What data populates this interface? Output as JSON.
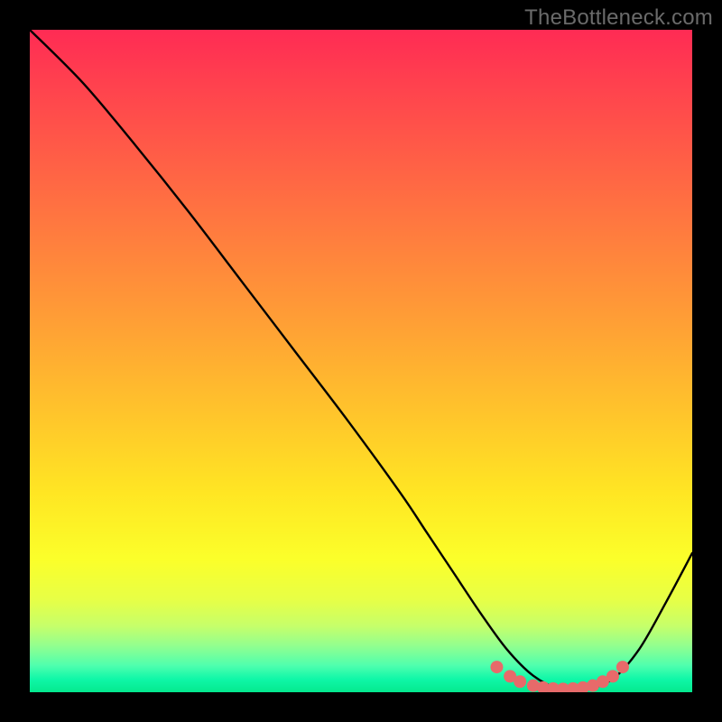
{
  "watermark": "TheBottleneck.com",
  "chart_data": {
    "type": "line",
    "title": "",
    "xlabel": "",
    "ylabel": "",
    "xlim": [
      0,
      100
    ],
    "ylim": [
      0,
      100
    ],
    "series": [
      {
        "name": "curve",
        "color": "#000000",
        "x": [
          0,
          8,
          16,
          24,
          32,
          40,
          48,
          56,
          60,
          64,
          68,
          72,
          76,
          80,
          84,
          88,
          92,
          96,
          100
        ],
        "y": [
          100,
          92,
          82.5,
          72.5,
          62,
          51.5,
          41,
          30,
          24,
          18,
          12,
          6.5,
          2.5,
          0.5,
          0.5,
          2,
          6.5,
          13.5,
          21
        ]
      },
      {
        "name": "markers",
        "color": "#e76a6a",
        "type": "scatter",
        "x": [
          70.5,
          72.5,
          74,
          76,
          77.5,
          79,
          80.5,
          82,
          83.5,
          85,
          86.5,
          88,
          89.5
        ],
        "y": [
          3.8,
          2.4,
          1.6,
          1.0,
          0.7,
          0.55,
          0.5,
          0.55,
          0.7,
          1.0,
          1.6,
          2.4,
          3.8
        ]
      }
    ],
    "background_gradient": {
      "stops": [
        {
          "pos": 0,
          "color": "#ff2b54"
        },
        {
          "pos": 7,
          "color": "#ff3e4f"
        },
        {
          "pos": 17,
          "color": "#ff5848"
        },
        {
          "pos": 30,
          "color": "#ff7a3f"
        },
        {
          "pos": 43,
          "color": "#ff9c36"
        },
        {
          "pos": 57,
          "color": "#ffc22c"
        },
        {
          "pos": 70,
          "color": "#ffe623"
        },
        {
          "pos": 80,
          "color": "#fbff2a"
        },
        {
          "pos": 86,
          "color": "#e7ff46"
        },
        {
          "pos": 90,
          "color": "#c6ff6a"
        },
        {
          "pos": 93,
          "color": "#92ff8f"
        },
        {
          "pos": 96,
          "color": "#4effae"
        },
        {
          "pos": 98,
          "color": "#10f7a8"
        },
        {
          "pos": 100,
          "color": "#04e98e"
        }
      ]
    }
  }
}
